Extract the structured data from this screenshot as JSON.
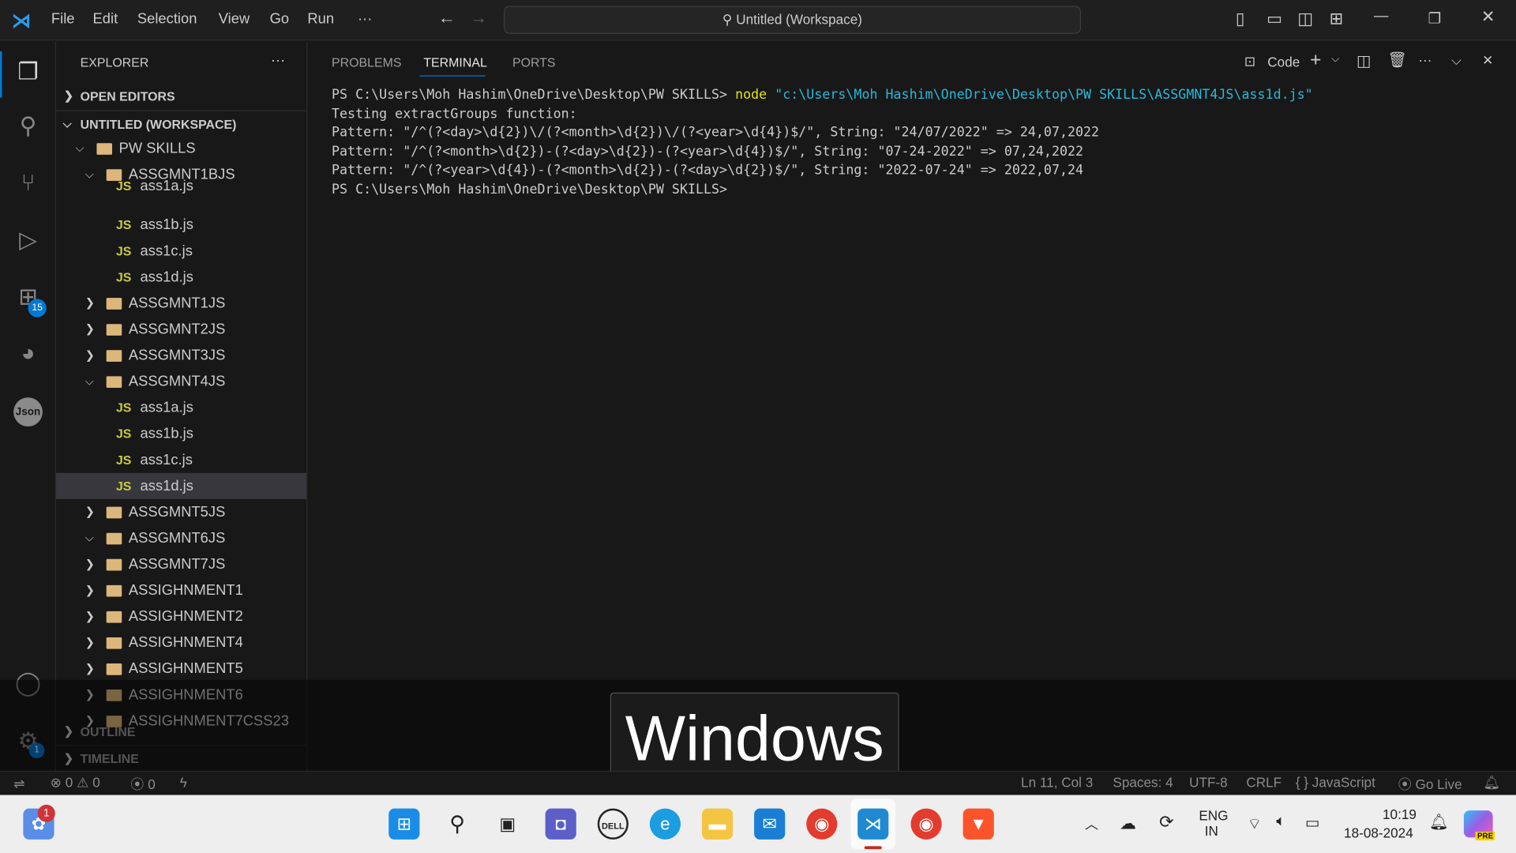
{
  "titlebar": {
    "menu": [
      "File",
      "Edit",
      "Selection",
      "View",
      "Go",
      "Run",
      "···"
    ],
    "search": "Untitled (Workspace)"
  },
  "activity": {
    "extensions_badge": "15",
    "settings_badge": "1",
    "json_label": "Json"
  },
  "sidebar": {
    "title": "EXPLORER",
    "more": "···",
    "open_editors": "OPEN EDITORS",
    "workspace": "UNTITLED (WORKSPACE)",
    "tree": [
      {
        "label": "PW SKILLS",
        "type": "root",
        "expanded": true,
        "depth": 0
      },
      {
        "label": "ASSGMNT1BJS",
        "type": "folder",
        "expanded": true,
        "depth": 1
      },
      {
        "label": "ass1a.js",
        "type": "js",
        "depth": 2
      },
      {
        "label": "ass1b.js",
        "type": "js",
        "depth": 2
      },
      {
        "label": "ass1c.js",
        "type": "js",
        "depth": 2
      },
      {
        "label": "ass1d.js",
        "type": "js",
        "depth": 2
      },
      {
        "label": "ASSGMNT1JS",
        "type": "folder",
        "expanded": false,
        "depth": 1
      },
      {
        "label": "ASSGMNT2JS",
        "type": "folder",
        "expanded": false,
        "depth": 1
      },
      {
        "label": "ASSGMNT3JS",
        "type": "folder",
        "expanded": false,
        "depth": 1
      },
      {
        "label": "ASSGMNT4JS",
        "type": "folder",
        "expanded": true,
        "depth": 1
      },
      {
        "label": "ass1a.js",
        "type": "js",
        "depth": 2
      },
      {
        "label": "ass1b.js",
        "type": "js",
        "depth": 2
      },
      {
        "label": "ass1c.js",
        "type": "js",
        "depth": 2
      },
      {
        "label": "ass1d.js",
        "type": "js",
        "depth": 2,
        "selected": true
      },
      {
        "label": "ASSGMNT5JS",
        "type": "folder",
        "expanded": false,
        "depth": 1
      },
      {
        "label": "ASSGMNT6JS",
        "type": "folder",
        "expanded": true,
        "depth": 1
      },
      {
        "label": "ASSGMNT7JS",
        "type": "folder",
        "expanded": false,
        "depth": 1
      },
      {
        "label": "ASSIGHNMENT1",
        "type": "folder",
        "expanded": false,
        "depth": 1
      },
      {
        "label": "ASSIGHNMENT2",
        "type": "folder",
        "expanded": false,
        "depth": 1
      },
      {
        "label": "ASSIGHNMENT4",
        "type": "folder",
        "expanded": false,
        "depth": 1
      },
      {
        "label": "ASSIGHNMENT5",
        "type": "folder",
        "expanded": false,
        "depth": 1
      },
      {
        "label": "ASSIGHNMENT6",
        "type": "folder",
        "expanded": false,
        "depth": 1
      },
      {
        "label": "ASSIGHNMENT7CSS23",
        "type": "folder",
        "expanded": false,
        "depth": 1
      }
    ],
    "outline": "OUTLINE",
    "timeline": "TIMELINE"
  },
  "panel": {
    "tabs": [
      "PROBLEMS",
      "TERMINAL",
      "PORTS"
    ],
    "active_tab": "TERMINAL",
    "terminal_name": "Code",
    "terminal": {
      "prompt": "PS C:\\Users\\Moh Hashim\\OneDrive\\Desktop\\PW SKILLS> ",
      "cmd": "node",
      "arg": "\"c:\\Users\\Moh Hashim\\OneDrive\\Desktop\\PW SKILLS\\ASSGMNT4JS\\ass1d.js\"",
      "lines": [
        "Testing extractGroups function:",
        "Pattern: \"/^(?<day>\\d{2})\\/(?<month>\\d{2})\\/(?<year>\\d{4})$/\", String: \"24/07/2022\" => 24,07,2022",
        "Pattern: \"/^(?<month>\\d{2})-(?<day>\\d{2})-(?<year>\\d{4})$/\", String: \"07-24-2022\" => 07,24,2022",
        "Pattern: \"/^(?<year>\\d{4})-(?<month>\\d{2})-(?<day>\\d{2})$/\", String: \"2022-07-24\" => 2022,07,24",
        "PS C:\\Users\\Moh Hashim\\OneDrive\\Desktop\\PW SKILLS> "
      ]
    }
  },
  "osd": "Windows",
  "status": {
    "errors": "0",
    "warnings": "0",
    "ports": "0",
    "position": "Ln 11, Col 3",
    "spaces": "Spaces: 4",
    "encoding": "UTF-8",
    "eol": "CRLF",
    "language": "JavaScript",
    "golive": "Go Live"
  },
  "taskbar": {
    "copilot_badge": "1",
    "lang1": "ENG",
    "lang2": "IN",
    "time": "10:19",
    "date": "18-08-2024",
    "pre": "PRE"
  }
}
